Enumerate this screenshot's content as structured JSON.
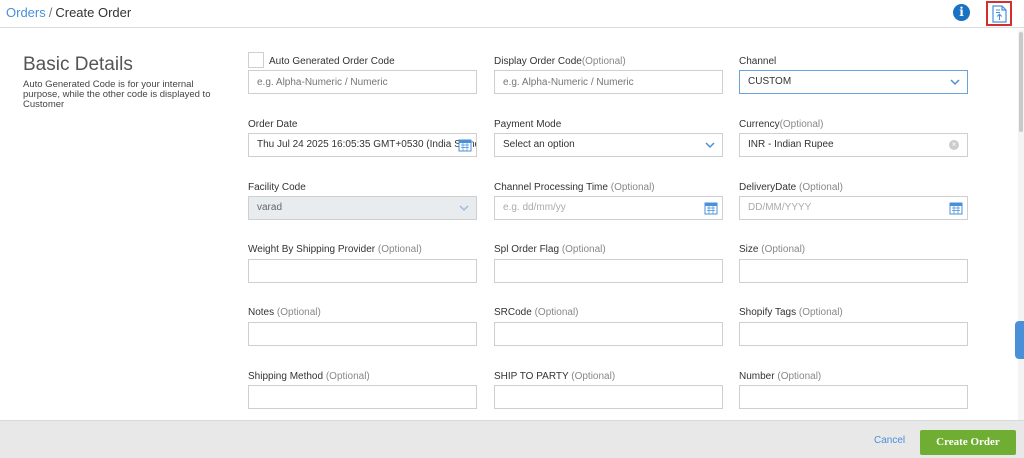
{
  "breadcrumb": {
    "parent": "Orders",
    "separator": "/",
    "current": "Create Order"
  },
  "header": {
    "info_icon": "info-icon",
    "info_glyph": "i",
    "upload_icon": "upload-document-icon"
  },
  "basic_details": {
    "title": "Basic Details",
    "description": "Auto Generated Code is for your internal purpose, while the other code is displayed to Customer"
  },
  "fields": {
    "auto_code": {
      "label": "Auto Generated Order Code",
      "placeholder": "e.g. Alpha-Numeric / Numeric"
    },
    "display_code": {
      "label": "Display Order Code",
      "optional": "(Optional)",
      "placeholder": "e.g. Alpha-Numeric / Numeric"
    },
    "channel": {
      "label": "Channel",
      "value": "CUSTOM"
    },
    "order_date": {
      "label": "Order Date",
      "value": "Thu Jul 24 2025 16:05:35 GMT+0530 (India Stand"
    },
    "payment_mode": {
      "label": "Payment Mode",
      "value": "Select an option"
    },
    "currency": {
      "label": "Currency",
      "optional": "(Optional)",
      "value": "INR - Indian Rupee"
    },
    "facility_code": {
      "label": "Facility Code",
      "value": "varad"
    },
    "channel_processing_time": {
      "label": "Channel Processing Time",
      "optional": "(Optional)",
      "placeholder": "e.g. dd/mm/yy"
    },
    "delivery_date": {
      "label": "DeliveryDate",
      "optional": "(Optional)",
      "placeholder": "DD/MM/YYYY"
    },
    "weight": {
      "label": "Weight By Shipping Provider",
      "optional": "(Optional)"
    },
    "spl_order_flag": {
      "label": "Spl Order Flag",
      "optional": "(Optional)"
    },
    "size": {
      "label": "Size",
      "optional": "(Optional)"
    },
    "notes": {
      "label": "Notes",
      "optional": "(Optional)"
    },
    "srcode": {
      "label": "SRCode",
      "optional": "(Optional)"
    },
    "shopify_tags": {
      "label": "Shopify Tags",
      "optional": "(Optional)"
    },
    "shipping_method": {
      "label": "Shipping Method",
      "optional": "(Optional)"
    },
    "ship_to_party": {
      "label": "SHIP TO PARTY",
      "optional": "(Optional)"
    },
    "number": {
      "label": "Number",
      "optional": "(Optional)"
    }
  },
  "footer": {
    "cancel": "Cancel",
    "create": "Create Order"
  },
  "colors": {
    "accent": "#4a90d9",
    "create_button": "#6fae33",
    "info": "#1a73c2",
    "highlight_border": "#d32f2f"
  }
}
